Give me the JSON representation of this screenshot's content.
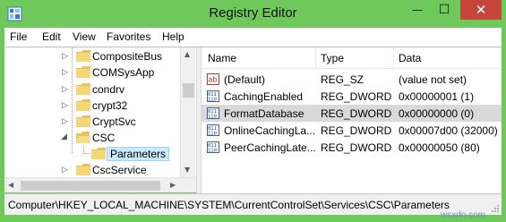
{
  "window": {
    "title": "Registry Editor",
    "accent": "#6fc85a",
    "close_color": "#c7463b"
  },
  "menu": {
    "items": [
      "File",
      "Edit",
      "View",
      "Favorites",
      "Help"
    ]
  },
  "tree": {
    "items": [
      {
        "label": "CompositeBus",
        "expander": "collapsed"
      },
      {
        "label": "COMSysApp",
        "expander": "collapsed"
      },
      {
        "label": "condrv",
        "expander": "collapsed"
      },
      {
        "label": "crypt32",
        "expander": "collapsed"
      },
      {
        "label": "CryptSvc",
        "expander": "collapsed"
      },
      {
        "label": "CSC",
        "expander": "expanded"
      },
      {
        "label": "Parameters",
        "expander": "none",
        "selected": true
      },
      {
        "label": "CscService",
        "expander": "collapsed"
      }
    ]
  },
  "list": {
    "columns": [
      "Name",
      "Type",
      "Data"
    ],
    "rows": [
      {
        "icon": "string-value-icon",
        "name": "(Default)",
        "type": "REG_SZ",
        "data": "(value not set)"
      },
      {
        "icon": "binary-value-icon",
        "name": "CachingEnabled",
        "type": "REG_DWORD",
        "data": "0x00000001 (1)"
      },
      {
        "icon": "binary-value-icon",
        "name": "FormatDatabase",
        "type": "REG_DWORD",
        "data": "0x00000000 (0)",
        "highlight": true
      },
      {
        "icon": "binary-value-icon",
        "name": "OnlineCachingLa...",
        "type": "REG_DWORD",
        "data": "0x00007d00 (32000)"
      },
      {
        "icon": "binary-value-icon",
        "name": "PeerCachingLate...",
        "type": "REG_DWORD",
        "data": "0x00000050 (80)"
      }
    ]
  },
  "status": {
    "path": "Computer\\HKEY_LOCAL_MACHINE\\SYSTEM\\CurrentControlSet\\Services\\CSC\\Parameters"
  },
  "watermark": "wsxdn.com"
}
